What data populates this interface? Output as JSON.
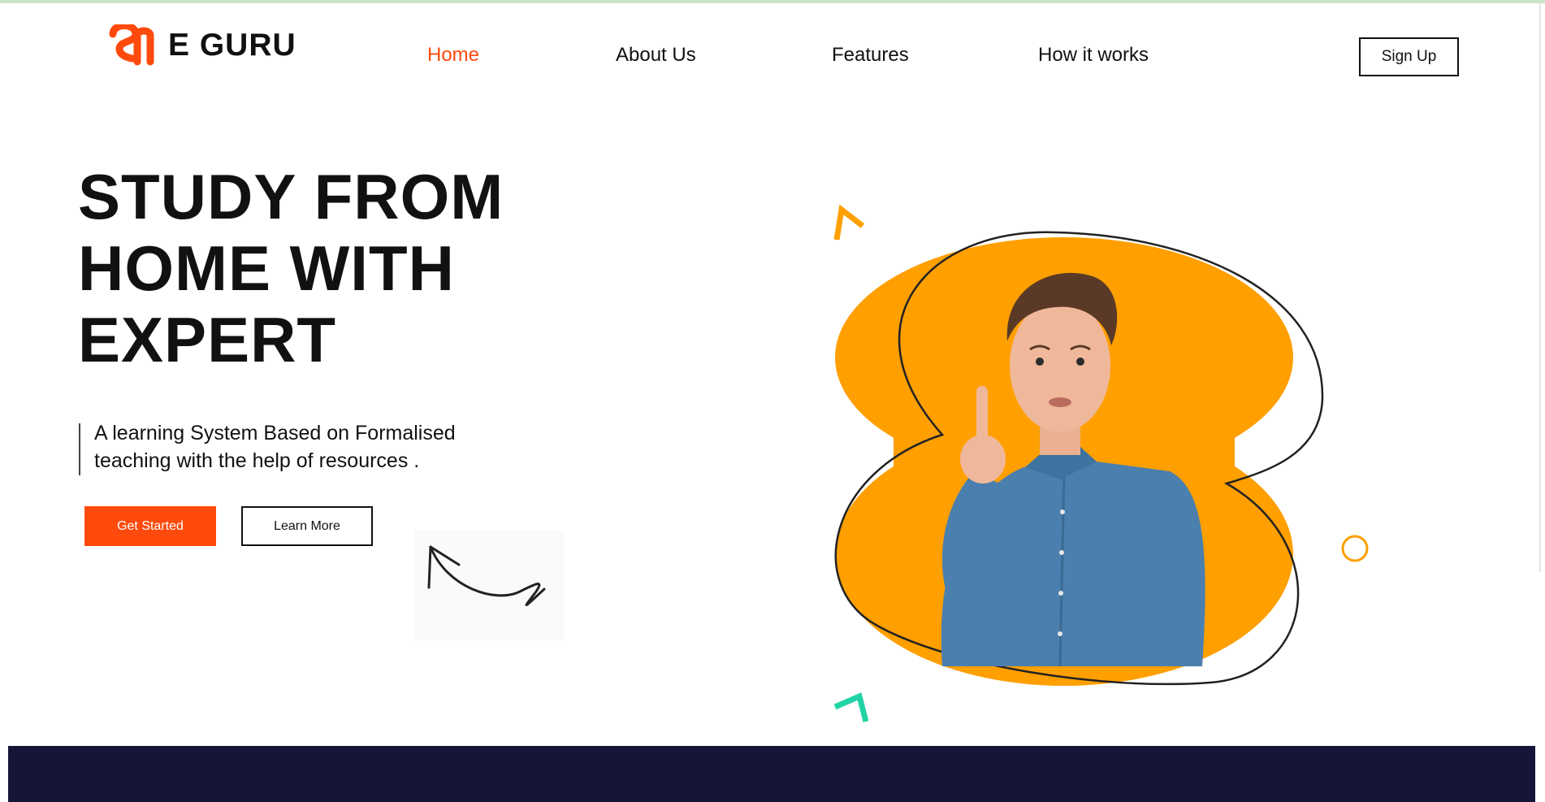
{
  "brand": {
    "name": "E GURU",
    "accent": "#ff4a0d"
  },
  "nav": {
    "items": [
      {
        "label": "Home",
        "active": true
      },
      {
        "label": "About Us",
        "active": false
      },
      {
        "label": "Features",
        "active": false
      },
      {
        "label": "How it works",
        "active": false
      }
    ],
    "signup_label": "Sign Up"
  },
  "hero": {
    "title_lines": [
      "STUDY FROM",
      "HOME WITH",
      "EXPERT"
    ],
    "tagline_lines": [
      "A learning System Based on Formalised",
      "teaching with the help of resources ."
    ],
    "primary_button": "Get Started",
    "secondary_button": "Learn More"
  },
  "colors": {
    "blob": "#ff9f00",
    "shirt": "#4b7fae",
    "skin": "#f0b89b",
    "footer": "#141538",
    "teal_mark": "#22d3a6",
    "circle_mark": "#ff9f00"
  },
  "icons": [
    "logo-mark-icon",
    "curved-arrow-icon",
    "orange-chevron-icon",
    "teal-chevron-icon",
    "ring-icon"
  ]
}
